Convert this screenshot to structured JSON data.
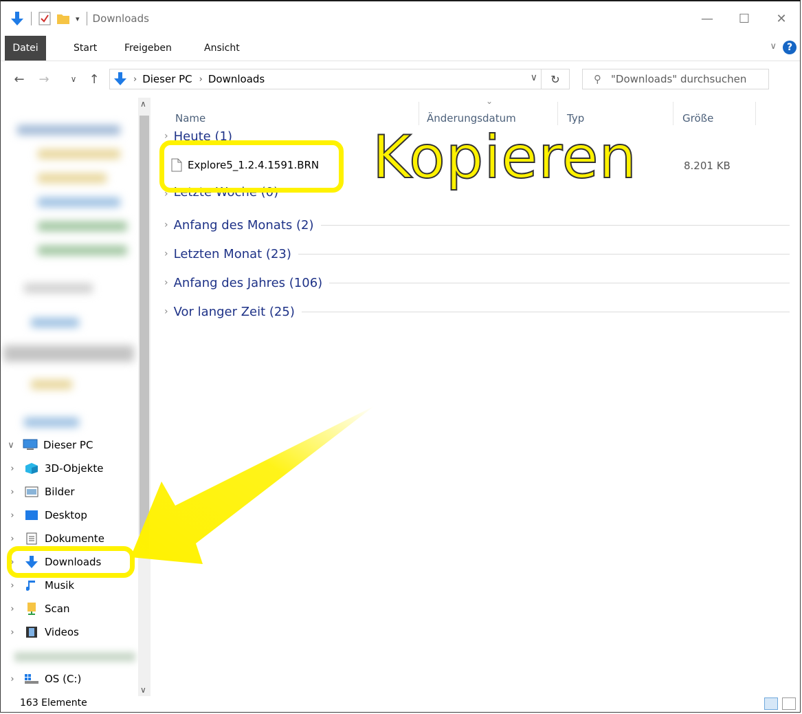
{
  "window": {
    "title": "Downloads",
    "minimize": "—",
    "maximize": "☐",
    "close": "✕"
  },
  "ribbon": {
    "tabs": [
      "Datei",
      "Start",
      "Freigeben",
      "Ansicht"
    ],
    "help": "?"
  },
  "address": {
    "crumbs": [
      "Dieser PC",
      "Downloads"
    ],
    "search_placeholder": "\"Downloads\" durchsuchen"
  },
  "columns": [
    "Name",
    "Änderungsdatum",
    "Typ",
    "Größe"
  ],
  "groups": [
    {
      "label": "Heute (1)"
    },
    {
      "label": "Letzte Woche (0)"
    },
    {
      "label": "Anfang des Monats (2)"
    },
    {
      "label": "Letzten Monat (23)"
    },
    {
      "label": "Anfang des Jahres (106)"
    },
    {
      "label": "Vor langer Zeit (25)"
    }
  ],
  "file": {
    "name": "Explore5_1.2.4.1591.BRN",
    "size": "8.201 KB"
  },
  "tree": {
    "root": "Dieser PC",
    "items": [
      "3D-Objekte",
      "Bilder",
      "Desktop",
      "Dokumente",
      "Downloads",
      "Musik",
      "Scan",
      "Videos",
      "OS (C:)"
    ]
  },
  "status": {
    "count": "163 Elemente"
  },
  "annotation": {
    "text": "Kopieren",
    "color": "#fff200"
  }
}
